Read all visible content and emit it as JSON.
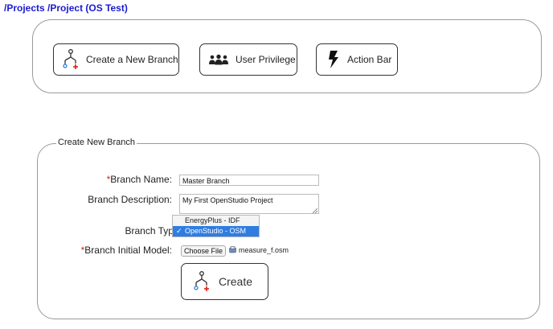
{
  "breadcrumb": {
    "projects": "/Projects",
    "project": "/Project (OS Test)"
  },
  "toolbar": {
    "create_branch": "Create a New Branch",
    "user_privilege": "User Privilege",
    "action_bar": "Action Bar"
  },
  "form": {
    "legend": "Create New Branch",
    "required_mark": "*",
    "branch_name_label": "Branch Name:",
    "branch_name_value": "Master Branch",
    "branch_description_label": "Branch Description:",
    "branch_description_value": "My First OpenStudio Project",
    "branch_type_label": "Branch Type:",
    "branch_type_options": [
      "EnergyPlus - IDF",
      "OpenStudio - OSM"
    ],
    "branch_type_checkmark": "✓",
    "initial_model_label": "Branch Initial Model:",
    "choose_file_label": "Choose File",
    "file_name": "measure_f.osm",
    "create_label": "Create"
  },
  "colors": {
    "link": "#1a1ad0",
    "required": "#d62020",
    "selected": "#2f7de1"
  },
  "icons": [
    "branch-icon",
    "users-icon",
    "lightning-icon",
    "file-icon"
  ]
}
